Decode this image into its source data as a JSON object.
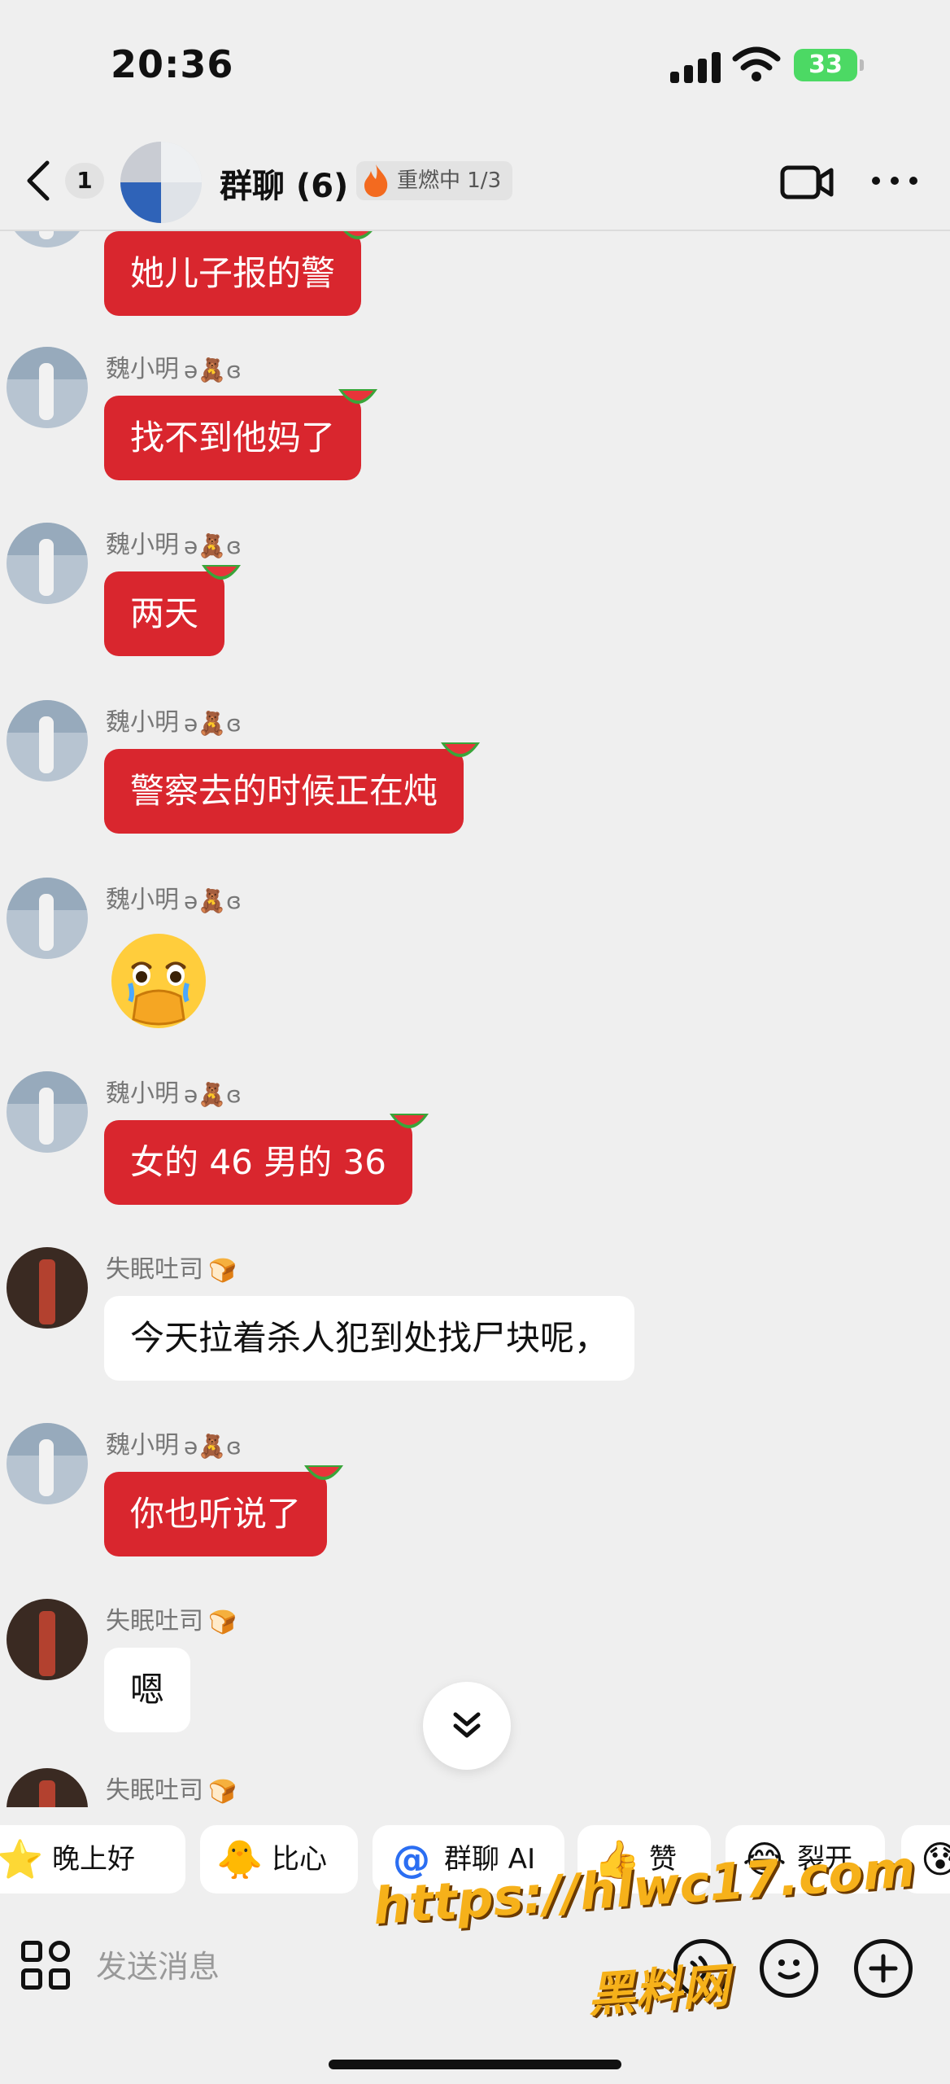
{
  "status_bar": {
    "time": "20:36",
    "battery": "33"
  },
  "header": {
    "unread_count": "1",
    "title": "群聊 (6)",
    "badge": "重燃中 1/3"
  },
  "messages": [
    {
      "sender": "",
      "text": "她儿子报的警"
    },
    {
      "sender": "魏小明",
      "text": "找不到他妈了"
    },
    {
      "sender": "魏小明",
      "text": "两天"
    },
    {
      "sender": "魏小明",
      "text": "警察去的时候正在炖"
    },
    {
      "sender": "魏小明",
      "text": "🥹"
    },
    {
      "sender": "魏小明",
      "text": "女的 46 男的 36"
    },
    {
      "sender": "失眠吐司",
      "text": "今天拉着杀人犯到处找尸块呢，"
    },
    {
      "sender": "魏小明",
      "text": "你也听说了"
    },
    {
      "sender": "失眠吐司",
      "text": "嗯"
    },
    {
      "sender": "失眠吐司",
      "text": ""
    }
  ],
  "sender_decorations": {
    "wei": "ə🧸ɞ",
    "shimian": "🍞"
  },
  "quick_replies": [
    {
      "icon": "⭐",
      "label": "晚上好"
    },
    {
      "icon": "🐥",
      "label": "比心"
    },
    {
      "icon": "@",
      "label": "群聊 AI"
    },
    {
      "icon": "👍",
      "label": "赞"
    },
    {
      "icon": "😂",
      "label": "裂开"
    }
  ],
  "input": {
    "placeholder": "发送消息"
  },
  "watermark": {
    "url": "https://hlwc17.com",
    "name": "黑料网"
  },
  "colors": {
    "bubble_red": "#d9262e",
    "background": "#efefef",
    "bubble_white": "#ffffff"
  }
}
